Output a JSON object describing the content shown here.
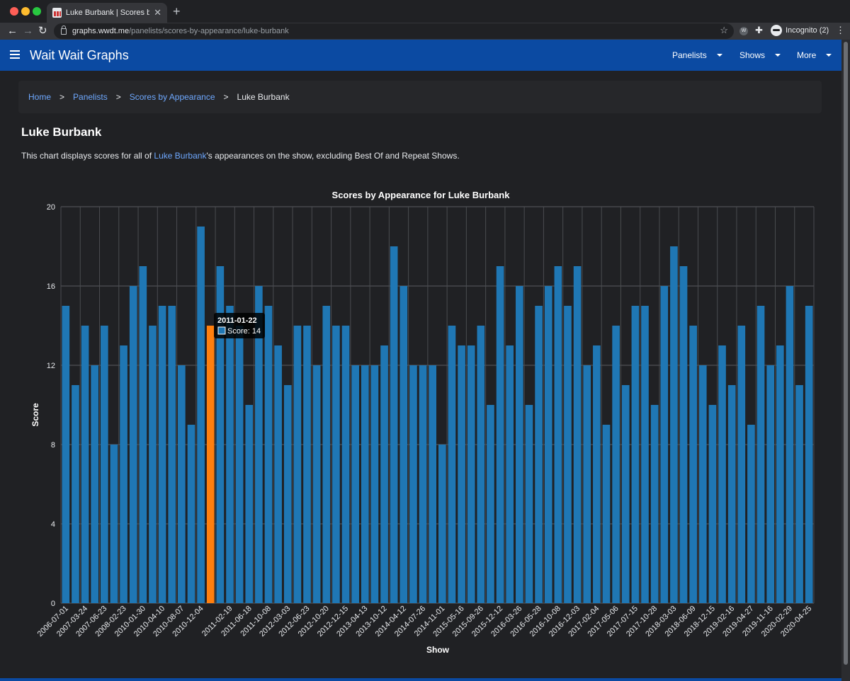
{
  "browser": {
    "tab_title": "Luke Burbank | Scores by Appe",
    "url_host": "graphs.wwdt.me",
    "url_path": "/panelists/scores-by-appearance/luke-burbank",
    "profile": "Incognito (2)"
  },
  "site": {
    "brand": "Wait Wait Graphs",
    "nav": [
      "Panelists",
      "Shows",
      "More"
    ]
  },
  "breadcrumb": {
    "items": [
      "Home",
      "Panelists",
      "Scores by Appearance"
    ],
    "separator": ">",
    "current": "Luke Burbank"
  },
  "page": {
    "title": "Luke Burbank",
    "desc_before": "This chart displays scores for all of ",
    "desc_link": "Luke Burbank",
    "desc_after": "'s appearances on the show, excluding Best Of and Repeat Shows."
  },
  "colors": {
    "bar": "#1f77b4",
    "bar_highlight": "#ff7f0e",
    "nav_bg": "#0b4aa2",
    "link": "#6ea8fe"
  },
  "chart_data": {
    "type": "bar",
    "title": "Scores by Appearance for Luke Burbank",
    "xlabel": "Show",
    "ylabel": "Score",
    "ylim": [
      0,
      20
    ],
    "yticks": [
      0,
      4,
      8,
      12,
      16,
      20
    ],
    "grid": true,
    "categories": [
      "2006-07-01",
      "",
      "2007-03-24",
      "",
      "2007-06-23",
      "",
      "2008-02-23",
      "",
      "2010-01-30",
      "",
      "2010-04-10",
      "",
      "2010-08-07",
      "",
      "2010-12-04",
      "",
      "2011-01-22",
      "2011-02-19",
      "",
      "2011-06-18",
      "",
      "2011-10-08",
      "",
      "2012-03-03",
      "",
      "2012-06-23",
      "",
      "2012-10-20",
      "",
      "2012-12-15",
      "",
      "2013-04-13",
      "",
      "2013-10-12",
      "",
      "2014-04-12",
      "",
      "2014-07-26",
      "",
      "2014-11-01",
      "",
      "2015-05-16",
      "",
      "2015-09-26",
      "",
      "2015-12-12",
      "",
      "2016-03-26",
      "",
      "2016-05-28",
      "",
      "2016-10-08",
      "",
      "2016-12-03",
      "",
      "2017-02-04",
      "",
      "2017-05-06",
      "",
      "2017-07-15",
      "",
      "2017-10-28",
      "",
      "2018-03-03",
      "",
      "2018-06-09",
      "",
      "2018-12-15",
      "",
      "2019-02-16",
      "",
      "2019-04-27",
      "",
      "2019-11-16",
      "",
      "2020-02-29",
      "",
      "2020-04-25",
      ""
    ],
    "tick_labels": [
      "2006-07-01",
      "2007-03-24",
      "2007-06-23",
      "2008-02-23",
      "2010-01-30",
      "2010-04-10",
      "2010-08-07",
      "2010-12-04",
      "2011-02-19",
      "2011-06-18",
      "2011-10-08",
      "2012-03-03",
      "2012-06-23",
      "2012-10-20",
      "2012-12-15",
      "2013-04-13",
      "2013-10-12",
      "2014-04-12",
      "2014-07-26",
      "2014-11-01",
      "2015-05-16",
      "2015-09-26",
      "2015-12-12",
      "2016-03-26",
      "2016-05-28",
      "2016-10-08",
      "2016-12-03",
      "2017-02-04",
      "2017-05-06",
      "2017-07-15",
      "2017-10-28",
      "2018-03-03",
      "2018-06-09",
      "2018-12-15",
      "2019-02-16",
      "2019-04-27",
      "2019-11-16",
      "2020-02-29",
      "2020-04-25"
    ],
    "series": [
      {
        "name": "Score",
        "values": [
          15,
          11,
          14,
          12,
          14,
          8,
          13,
          16,
          17,
          14,
          15,
          15,
          12,
          9,
          19,
          14,
          17,
          15,
          14,
          10,
          16,
          15,
          13,
          11,
          14,
          14,
          12,
          15,
          14,
          14,
          12,
          12,
          12,
          13,
          18,
          16,
          12,
          12,
          12,
          8,
          14,
          13,
          13,
          14,
          10,
          17,
          13,
          16,
          10,
          15,
          16,
          17,
          15,
          17,
          12,
          13,
          9,
          14,
          11,
          15,
          15,
          10,
          16,
          18,
          17,
          14,
          12,
          10,
          13,
          11,
          14,
          9,
          15,
          12,
          13,
          16,
          11,
          15
        ]
      }
    ],
    "highlight_index": 15,
    "tooltip": {
      "title": "2011-01-22",
      "label": "Score: 14"
    }
  }
}
